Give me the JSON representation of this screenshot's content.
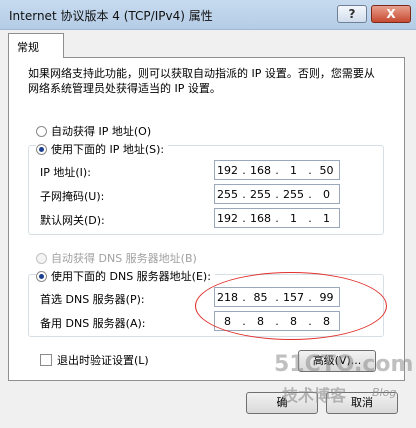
{
  "window": {
    "title": "Internet 协议版本 4 (TCP/IPv4) 属性",
    "help_label": "?",
    "close_label": "X"
  },
  "tab": {
    "label": "常规"
  },
  "description": "如果网络支持此功能，则可以获取自动指派的 IP 设置。否则，您需要从网络系统管理员处获得适当的 IP 设置。",
  "ip": {
    "auto_label": "自动获得 IP 地址(O)",
    "manual_label": "使用下面的 IP 地址(S):",
    "selected": "manual",
    "fields": [
      {
        "label": "IP 地址(I):",
        "octets": [
          "192",
          "168",
          "1",
          "50"
        ]
      },
      {
        "label": "子网掩码(U):",
        "octets": [
          "255",
          "255",
          "255",
          "0"
        ]
      },
      {
        "label": "默认网关(D):",
        "octets": [
          "192",
          "168",
          "1",
          "1"
        ]
      }
    ]
  },
  "dns": {
    "auto_label": "自动获得 DNS 服务器地址(B)",
    "manual_label": "使用下面的 DNS 服务器地址(E):",
    "selected": "manual",
    "fields": [
      {
        "label": "首选 DNS 服务器(P):",
        "octets": [
          "218",
          "85",
          "157",
          "99"
        ]
      },
      {
        "label": "备用 DNS 服务器(A):",
        "octets": [
          "8",
          "8",
          "8",
          "8"
        ]
      }
    ]
  },
  "validate": {
    "label": "退出时验证设置(L)",
    "checked": false
  },
  "buttons": {
    "advanced_label": "高级(V)...",
    "ok_label": "确",
    "cancel_label": "取消"
  },
  "watermark": {
    "main": "51CTO.com",
    "sub": "技术博客",
    "blog": "Blog"
  },
  "colors": {
    "annotation": "#e0302c",
    "titlebar": "#c7dbef"
  }
}
